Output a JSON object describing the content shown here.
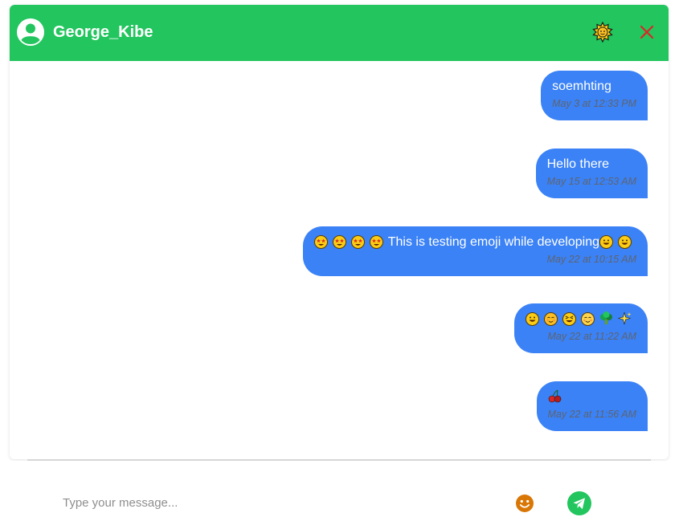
{
  "colors": {
    "header_bg": "#22c55e",
    "bubble_bg": "#3b82f6",
    "close_icon": "#dc2626",
    "send_button": "#22c55e",
    "emoji_button": "#d97706"
  },
  "header": {
    "contact_name": "George_Kibe",
    "avatar_icon": "user-avatar-icon",
    "theme_icon": "sun-icon",
    "close_icon": "close-icon"
  },
  "messages": [
    {
      "text": "soemhting",
      "emojis_before": [],
      "emojis_after": [],
      "time": "May 3 at 12:33 PM"
    },
    {
      "text": "Hello there",
      "emojis_before": [],
      "emojis_after": [],
      "time": "May 15 at 12:53 AM"
    },
    {
      "text": "This is testing emoji while developing",
      "emojis_before": [
        "star-struck",
        "star-struck",
        "star-struck",
        "star-struck"
      ],
      "emojis_after": [
        "grinning",
        "grinning"
      ],
      "time": "May 22 at 10:15 AM"
    },
    {
      "text": "",
      "emojis_before": [
        "grinning-smiling-eyes",
        "blushing",
        "squinting-laughing",
        "smiling-eyes",
        "broccoli",
        "sparkles"
      ],
      "emojis_after": [],
      "time": "May 22 at 11:22 AM"
    },
    {
      "text": "",
      "emojis_before": [
        "cherries"
      ],
      "emojis_after": [],
      "time": "May 22 at 11:56 AM"
    }
  ],
  "composer": {
    "placeholder": "Type your message...",
    "value": "",
    "emoji_icon": "smiley-icon",
    "send_icon": "send-icon"
  }
}
